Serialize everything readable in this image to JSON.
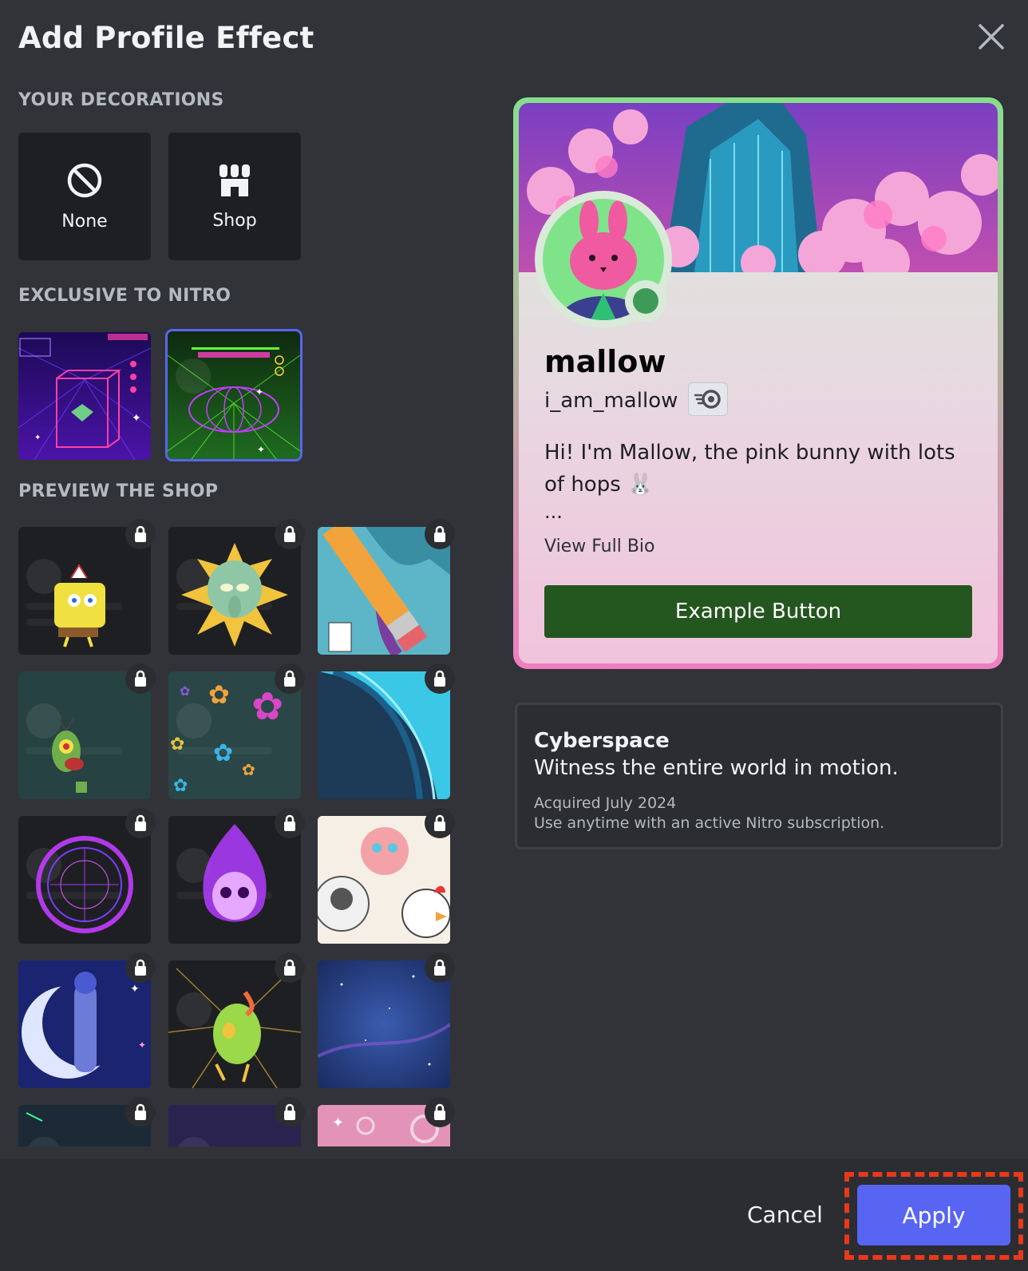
{
  "dialog": {
    "title": "Add Profile Effect"
  },
  "sections": {
    "your_decorations": "YOUR DECORATIONS",
    "exclusive": "EXCLUSIVE TO NITRO",
    "preview_shop": "PREVIEW THE SHOP"
  },
  "decorations": [
    {
      "label": "None",
      "icon": "none-icon"
    },
    {
      "label": "Shop",
      "icon": "shop-icon"
    }
  ],
  "nitro_effects": [
    {
      "name": "nitro-effect-1",
      "selected": false
    },
    {
      "name": "nitro-effect-2",
      "selected": true
    }
  ],
  "shop_items_locked": 15,
  "profile": {
    "display_name": "mallow",
    "username": "i_am_mallow",
    "bio": "Hi! I'm Mallow, the pink bunny with lots of hops 🐰",
    "bio_more": "...",
    "view_full_bio": "View Full Bio",
    "example_button": "Example Button"
  },
  "effect_info": {
    "name": "Cyberspace",
    "description": "Witness the entire world in motion.",
    "acquired": "Acquired July 2024",
    "usage": "Use anytime with an active Nitro subscription."
  },
  "footer": {
    "cancel": "Cancel",
    "apply": "Apply"
  },
  "colors": {
    "accent": "#5865f2",
    "background": "#313338",
    "example_button": "#245620",
    "status_online": "#3e9b57"
  }
}
